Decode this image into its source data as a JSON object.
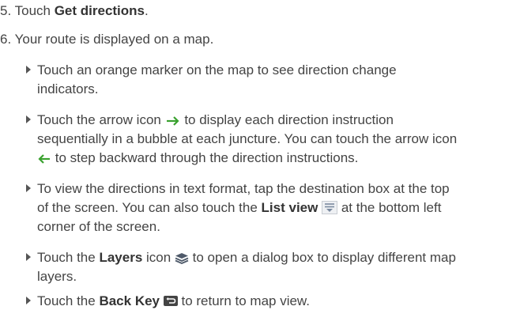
{
  "colors": {
    "text": "#444444",
    "bold_text": "#333333",
    "arrow_icon": "#3aa12f",
    "list_view_icon": "#7a8aa0",
    "layers_icon": "#4f5a6a",
    "back_key": "#444444"
  },
  "steps": [
    {
      "number": "5.",
      "text_before": "Touch ",
      "bold": "Get directions",
      "text_after": "."
    },
    {
      "number": "6.",
      "text": "Your route is displayed on a map."
    }
  ],
  "bullets": [
    {
      "lines": [
        "Touch an orange marker on the map to see direction change",
        "indicators."
      ]
    },
    {
      "l1_before": "Touch the arrow icon ",
      "l1_icon": "arrow-right-icon",
      "l1_after": " to display each direction instruction",
      "l2": "sequentially in a bubble at each juncture. You can touch the arrow icon",
      "l3_icon": "arrow-left-icon",
      "l3_after": " to step backward through the direction instructions."
    },
    {
      "l1": "To view the directions in text format, tap the destination box at the top",
      "l2_before": "of the screen. You can also touch the ",
      "l2_bold": "List view",
      "l2_icon": "list-view-icon",
      "l2_after": " at the bottom left",
      "l3": "corner of the screen."
    },
    {
      "l1_before": "Touch the ",
      "l1_bold": "Layers",
      "l1_mid": " icon ",
      "l1_icon": "layers-icon",
      "l1_after": " to open a dialog box to display different map",
      "l2": "layers."
    },
    {
      "l1_before": "Touch the ",
      "l1_bold": "Back Key",
      "l1_icon": "back-key-icon",
      "l1_after": " to return to map view."
    }
  ]
}
